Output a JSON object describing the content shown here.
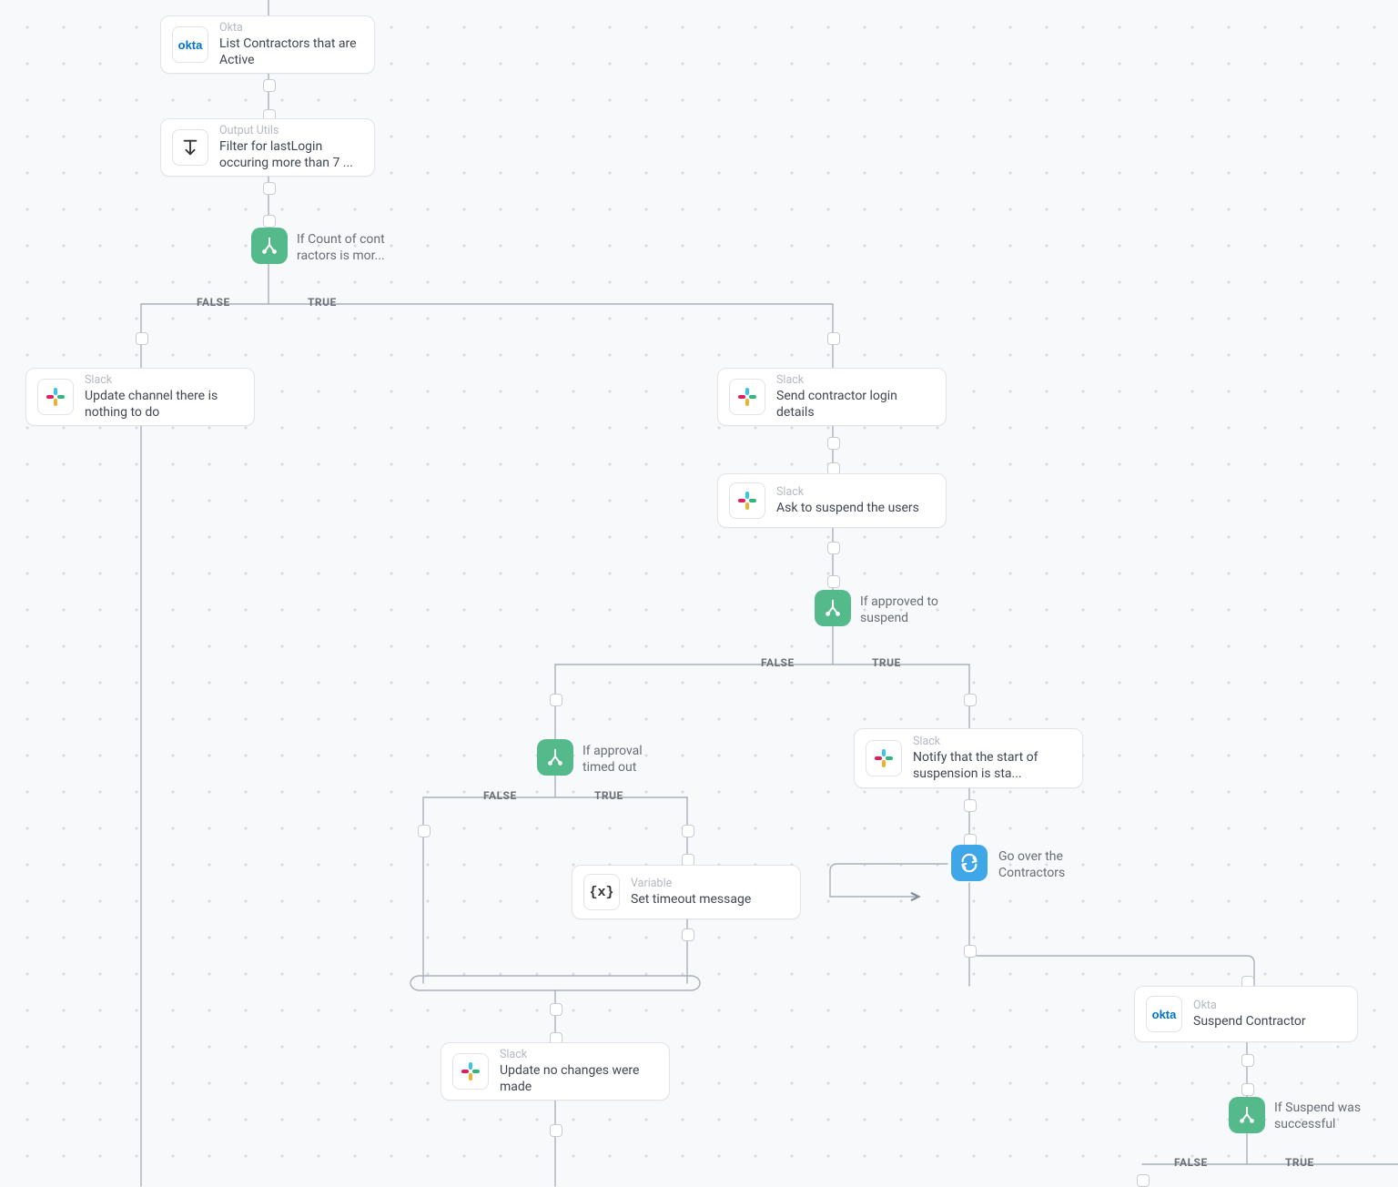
{
  "branch": {
    "true": "TRUE",
    "false": "FALSE"
  },
  "n_okta1": {
    "svc": "Okta",
    "title": "List Contractors that are Active"
  },
  "n_filter": {
    "svc": "Output Utils",
    "title": "Filter for lastLogin occuring more than 7 ..."
  },
  "c_count": {
    "title": "If Count of cont ractors is mor..."
  },
  "n_nothing": {
    "svc": "Slack",
    "title": "Update channel there is nothing to do"
  },
  "n_senddet": {
    "svc": "Slack",
    "title": "Send contractor login details"
  },
  "n_ask": {
    "svc": "Slack",
    "title": "Ask to suspend the users"
  },
  "c_approved": {
    "title": "If approved to suspend"
  },
  "c_timeout": {
    "title": "If approval timed out"
  },
  "n_notify": {
    "svc": "Slack",
    "title": "Notify that the start of suspension is sta..."
  },
  "n_settimeout": {
    "svc": "Variable",
    "title": "Set timeout message"
  },
  "loop_over": {
    "title": "Go over the Contractors"
  },
  "n_nochanges": {
    "svc": "Slack",
    "title": "Update no changes were made"
  },
  "n_suspend": {
    "svc": "Okta",
    "title": "Suspend Contractor"
  },
  "c_suspendok": {
    "title": "If Suspend was successful"
  },
  "okta_text": "okta"
}
